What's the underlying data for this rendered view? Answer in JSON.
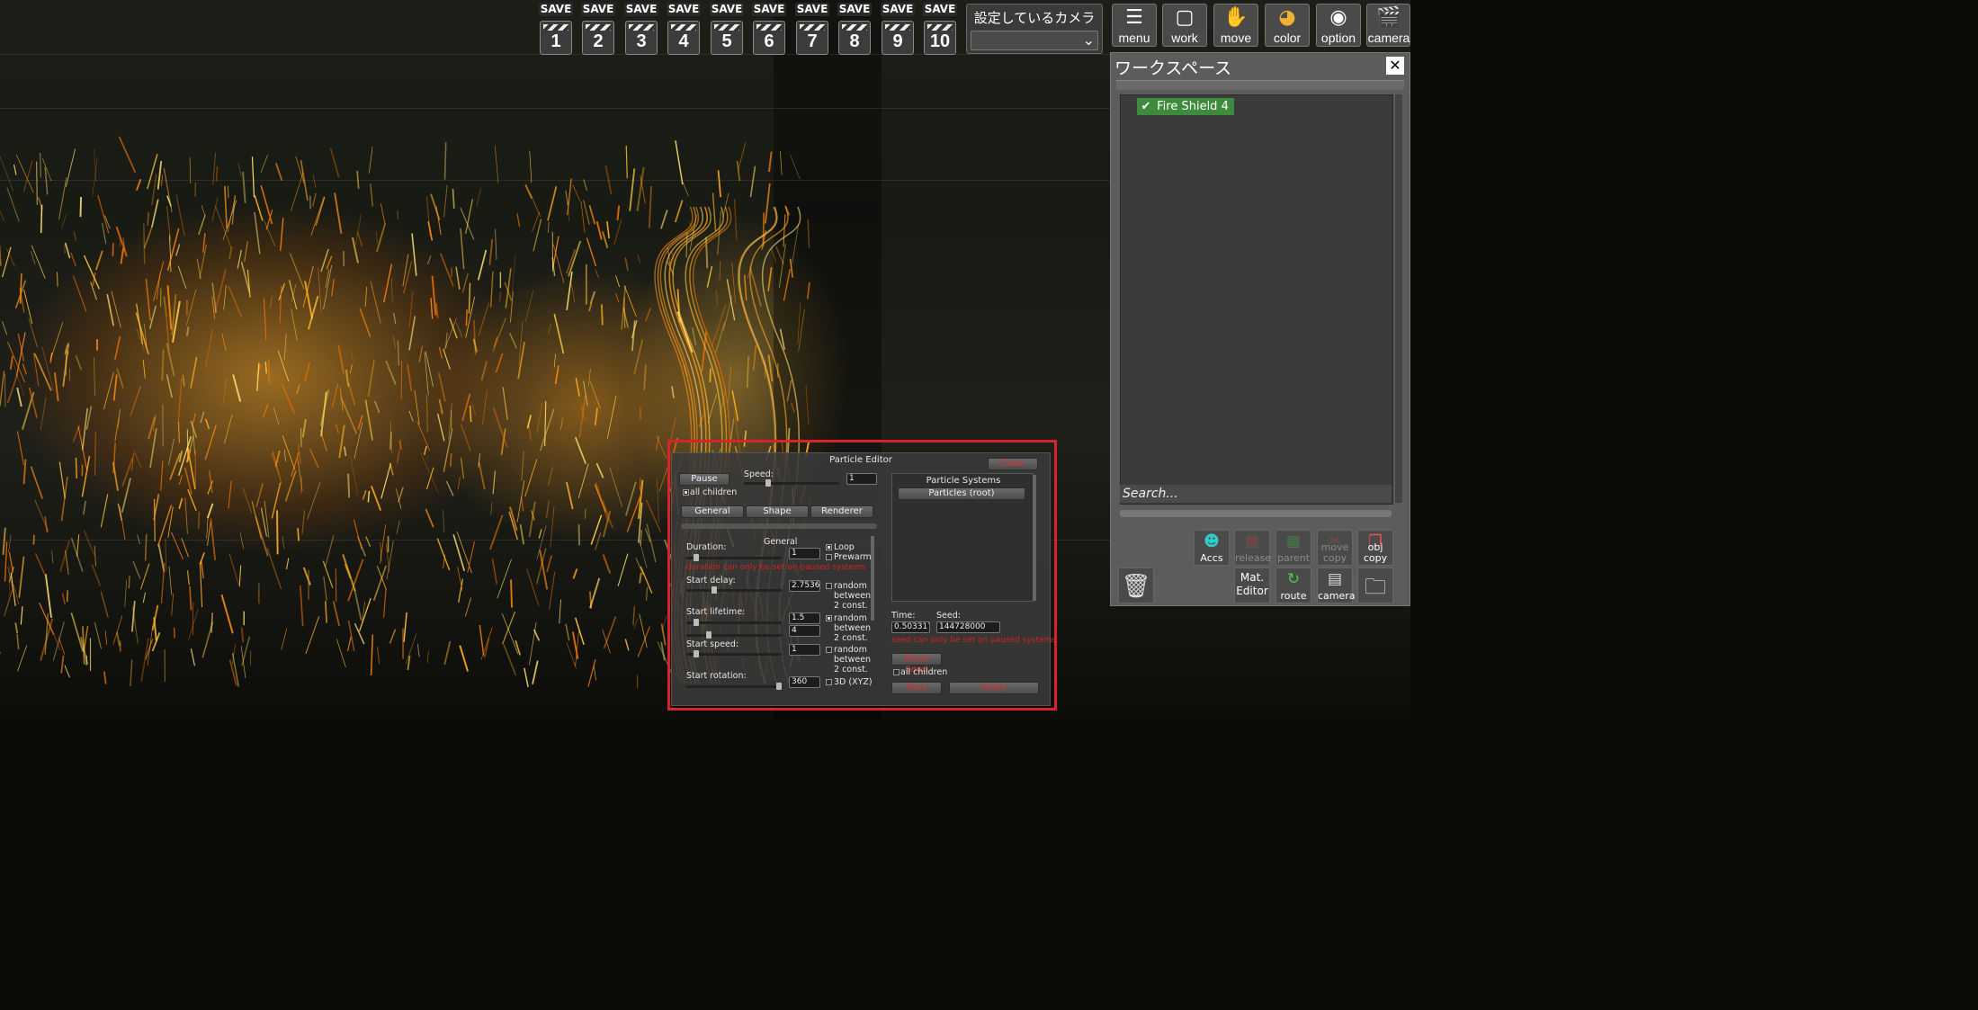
{
  "save_slots": [
    {
      "label": "SAVE",
      "number": "1"
    },
    {
      "label": "SAVE",
      "number": "2"
    },
    {
      "label": "SAVE",
      "number": "3"
    },
    {
      "label": "SAVE",
      "number": "4"
    },
    {
      "label": "SAVE",
      "number": "5"
    },
    {
      "label": "SAVE",
      "number": "6"
    },
    {
      "label": "SAVE",
      "number": "7"
    },
    {
      "label": "SAVE",
      "number": "8"
    },
    {
      "label": "SAVE",
      "number": "9"
    },
    {
      "label": "SAVE",
      "number": "10"
    }
  ],
  "camera_select": {
    "label": "設定しているカメラ",
    "value": ""
  },
  "toolbar": [
    {
      "name": "menu",
      "label": "menu",
      "icon": "list-icon"
    },
    {
      "name": "work",
      "label": "work",
      "icon": "frame-icon"
    },
    {
      "name": "move",
      "label": "move",
      "icon": "hand-icon"
    },
    {
      "name": "color",
      "label": "color",
      "icon": "palette-icon"
    },
    {
      "name": "option",
      "label": "option",
      "icon": "eye-icon"
    },
    {
      "name": "camera",
      "label": "camera",
      "icon": "clapper-icon"
    }
  ],
  "workspace": {
    "title": "ワークスペース",
    "items": [
      {
        "label": "Fire Shield 4",
        "checked": true
      }
    ],
    "search_placeholder": "Search...",
    "buttons": {
      "accs": "Accs",
      "release": "release",
      "parent": "parent",
      "move_copy": "move copy",
      "obj_copy": "obj copy",
      "mat_editor": "Mat. Editor",
      "route": "route",
      "camera": "camera"
    }
  },
  "particle_editor": {
    "title": "Particle Editor",
    "close": "Close",
    "pause": "Pause",
    "speed_label": "Speed:",
    "speed_value": "1",
    "all_children": "all children",
    "tabs": [
      "General",
      "Shape",
      "Renderer"
    ],
    "section_title": "General",
    "duration_label": "Duration:",
    "duration_value": "1",
    "loop": "Loop",
    "prewarm": "Prewarm",
    "duration_note": "duration can only be set on paused systems",
    "start_delay_label": "Start delay:",
    "start_delay_value": "2.75362",
    "start_lifetime_label": "Start lifetime:",
    "start_lifetime_min": "1.5",
    "start_lifetime_max": "4",
    "start_speed_label": "Start speed:",
    "start_speed_value": "1",
    "start_rotation_label": "Start rotation:",
    "start_rotation_value": "360",
    "random_between": "random",
    "random_between_2": "between",
    "random_between_3": "2 const.",
    "rotation_3d": "3D (XYZ)",
    "systems_title": "Particle Systems",
    "systems": [
      "Particles (root)"
    ],
    "time_label": "Time:",
    "time_value": "0.503317",
    "seed_label": "Seed:",
    "seed_value": "144728000",
    "seed_note": "seed can only be set on paused systems",
    "reset_seed": "Reset Seed",
    "all_children_2": "all children",
    "btn_left": "Save",
    "btn_right": "Apply"
  },
  "colors": {
    "highlight": "#d8222c",
    "workspace_item": "#3d8c3d",
    "warning_text": "#d52222"
  }
}
